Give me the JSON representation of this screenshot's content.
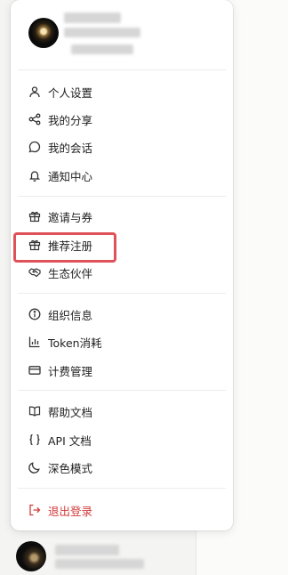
{
  "menu": {
    "groups": [
      {
        "items": [
          {
            "label": "个人设置",
            "icon": "user-icon"
          },
          {
            "label": "我的分享",
            "icon": "share-icon"
          },
          {
            "label": "我的会话",
            "icon": "chat-bubble-icon"
          },
          {
            "label": "通知中心",
            "icon": "bell-icon"
          }
        ]
      },
      {
        "items": [
          {
            "label": "邀请与券",
            "icon": "gift-icon"
          },
          {
            "label": "推荐注册",
            "icon": "gift-icon"
          },
          {
            "label": "生态伙伴",
            "icon": "handshake-icon"
          }
        ]
      },
      {
        "items": [
          {
            "label": "组织信息",
            "icon": "info-icon"
          },
          {
            "label": "Token消耗",
            "icon": "bar-chart-icon"
          },
          {
            "label": "计费管理",
            "icon": "credit-card-icon"
          }
        ]
      },
      {
        "items": [
          {
            "label": "帮助文档",
            "icon": "book-icon"
          },
          {
            "label": "API 文档",
            "icon": "braces-icon"
          },
          {
            "label": "深色模式",
            "icon": "moon-icon"
          }
        ]
      },
      {
        "items": [
          {
            "label": "退出登录",
            "icon": "logout-icon"
          }
        ]
      }
    ],
    "highlight_color": "#e0525a",
    "logout_color": "#d33b3b"
  }
}
